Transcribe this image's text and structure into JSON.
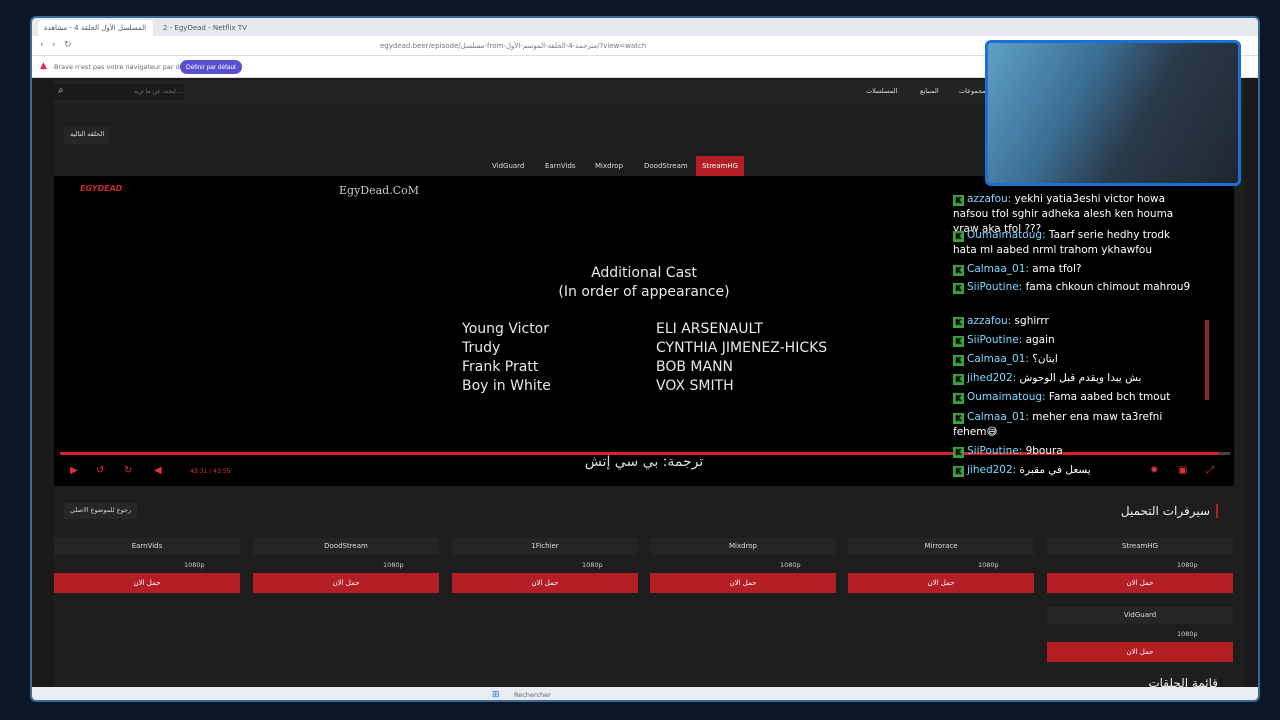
{
  "browser": {
    "tabs": [
      "المسلسل الأول الحلقة 4 - مشاهدة",
      "2 - EgyDead - Netflix TV"
    ],
    "url": "egydead.beer/episode/مسلسل-from-مترجمة-4-الحلقة-الموسم-الأول/?view=watch",
    "info_message": "Brave n'est pas votre navigateur par défaut",
    "info_button": "Définir par défaut"
  },
  "site": {
    "search_placeholder": "ابحث عن ما تريد ...",
    "nav": [
      "المسلسلات",
      "المنيايع",
      "مجموعات"
    ],
    "prev_episode": "الحلقه التاليه",
    "server_tabs": [
      "VidGuard",
      "EarnVids",
      "Mixdrop",
      "DoodStream",
      "StreamHG"
    ],
    "active_server": "StreamHG"
  },
  "player": {
    "logo": "EGYDEAD",
    "watermark": "EgyDead.CoM",
    "credits_title": "Additional Cast",
    "credits_subtitle": "(In order of appearance)",
    "cast": [
      {
        "role": "Young Victor",
        "actor": "ELI ARSENAULT"
      },
      {
        "role": "Trudy",
        "actor": "CYNTHIA JIMENEZ-HICKS"
      },
      {
        "role": "Frank Pratt",
        "actor": "BOB MANN"
      },
      {
        "role": "Boy in White",
        "actor": "VOX SMITH"
      }
    ],
    "subtitle": "ترجمة: بي سي إتش",
    "time": "43:31 / 43:55",
    "progress": 0.99
  },
  "downloads": {
    "back_button": "رجوع للموضوع الاصلي",
    "title": "سيرفرات التحميل",
    "servers": [
      {
        "name": "EarnVids",
        "quality": "1080p",
        "button": "حمل الان"
      },
      {
        "name": "DoodStream",
        "quality": "1080p",
        "button": "حمل الان"
      },
      {
        "name": "1Fichier",
        "quality": "1080p",
        "button": "حمل الان"
      },
      {
        "name": "Mixdrop",
        "quality": "1080p",
        "button": "حمل الان"
      },
      {
        "name": "Mirrorace",
        "quality": "1080p",
        "button": "حمل الان"
      },
      {
        "name": "StreamHG",
        "quality": "1080p",
        "button": "حمل الان"
      },
      {
        "name": "VidGuard",
        "quality": "1080p",
        "button": "حمل الان"
      }
    ],
    "episodes_title": "قائمة الحلقات"
  },
  "chat": [
    {
      "user": "azzafou",
      "text": "yekhi yatia3eshi victor howa nafsou tfol sghir adheka alesh ken houma yraw aka tfol ???"
    },
    {
      "user": "Oumaimatoug",
      "text": "Taarf serie hedhy trodk hata ml aabed nrml trahom ykhawfou"
    },
    {
      "user": "Calmaa_01",
      "text": "ama tfol?"
    },
    {
      "user": "SiiPoutine",
      "text": "fama chkoun chimout mahrou9"
    },
    {
      "user": "azzafou",
      "text": "sghirrr"
    },
    {
      "user": "SiiPoutine",
      "text": "again"
    },
    {
      "user": "Calmaa_01",
      "text": "ايتان؟"
    },
    {
      "user": "jihed202",
      "text": "بش يبدا ويقدم قبل الوحوش"
    },
    {
      "user": "Oumaimatoug",
      "text": "Fama aabed bch tmout"
    },
    {
      "user": "Calmaa_01",
      "text": "meher ena maw ta3refni fehem😅"
    },
    {
      "user": "SiiPoutine",
      "text": "9boura"
    },
    {
      "user": "jihed202",
      "text": "يسعل في مقبرة"
    }
  ],
  "taskbar": {
    "search": "Rechercher"
  },
  "colors": {
    "accent": "#b31f24",
    "chat_badge": "#3fa63f",
    "frame": "#1c6fd4"
  }
}
